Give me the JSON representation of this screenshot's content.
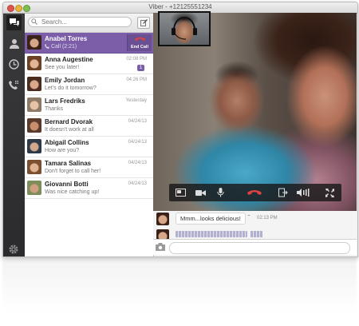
{
  "window": {
    "title": "Viber - +12125551234"
  },
  "search": {
    "placeholder": "Search..."
  },
  "contacts": [
    {
      "name": "Anabel Torres",
      "sub": "Call (2:21)",
      "time": "",
      "badge": "",
      "active": true,
      "end_call_label": "End Call"
    },
    {
      "name": "Anna Augestine",
      "sub": "See you later!",
      "time": "02:08 PM",
      "badge": "1"
    },
    {
      "name": "Emily Jordan",
      "sub": "Let's do it tomorrow?",
      "time": "04:26 PM",
      "badge": ""
    },
    {
      "name": "Lars Fredriks",
      "sub": "Thanks",
      "time": "Yesterday",
      "badge": ""
    },
    {
      "name": "Bernard Dvorak",
      "sub": "It doesn't work at all",
      "time": "04/24/13",
      "badge": ""
    },
    {
      "name": "Abigail Collins",
      "sub": "How are you?",
      "time": "04/24/13",
      "badge": ""
    },
    {
      "name": "Tamara Salinas",
      "sub": "Don't forget to call her!",
      "time": "04/24/13",
      "badge": ""
    },
    {
      "name": "Giovanni Botti",
      "sub": "Was nice catching up!",
      "time": "04/24/13",
      "badge": ""
    }
  ],
  "chat": {
    "ellipsis": "...",
    "messages": [
      {
        "text": "Mmm...looks delicious!",
        "time": "02:13 PM"
      }
    ]
  },
  "colors": {
    "accent": "#7b5ea7",
    "end_call": "#e04242",
    "rail": "#2f2f31"
  }
}
